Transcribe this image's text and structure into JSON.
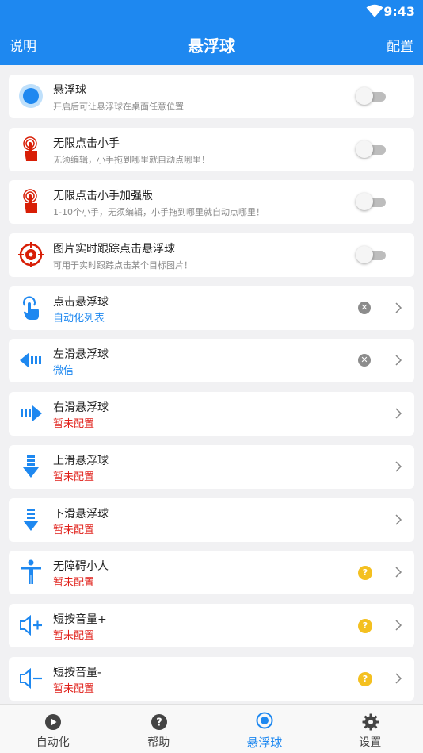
{
  "status_bar": {
    "time": "9:43"
  },
  "app_bar": {
    "left_label": "说明",
    "title": "悬浮球",
    "right_label": "配置"
  },
  "items": [
    {
      "title": "悬浮球",
      "desc": "开启后可让悬浮球在桌面任意位置",
      "icon": "floating-ball-icon"
    },
    {
      "title": "无限点击小手",
      "desc": "无须编辑，小手拖到哪里就自动点哪里！",
      "icon": "tap-hand-icon"
    },
    {
      "title": "无限点击小手加强版",
      "desc": "1-10个小手，无须编辑，小手拖到哪里就自动点哪里！",
      "icon": "tap-hand-plus-icon"
    },
    {
      "title": "图片实时跟踪点击悬浮球",
      "desc": "可用于实时跟踪点击某个目标图片！",
      "icon": "target-icon"
    },
    {
      "title": "点击悬浮球",
      "sub": "自动化列表",
      "icon": "touch-icon"
    },
    {
      "title": "左滑悬浮球",
      "sub": "微信",
      "icon": "swipe-left-icon"
    },
    {
      "title": "右滑悬浮球",
      "sub": "暂未配置",
      "icon": "swipe-right-icon"
    },
    {
      "title": "上滑悬浮球",
      "sub": "暂未配置",
      "icon": "swipe-up-icon"
    },
    {
      "title": "下滑悬浮球",
      "sub": "暂未配置",
      "icon": "swipe-down-icon"
    },
    {
      "title": "无障碍小人",
      "sub": "暂未配置",
      "icon": "accessibility-icon"
    },
    {
      "title": "短按音量+",
      "sub": "暂未配置",
      "icon": "volume-up-icon"
    },
    {
      "title": "短按音量-",
      "sub": "暂未配置",
      "icon": "volume-down-icon"
    }
  ],
  "bottom_nav": [
    {
      "label": "自动化",
      "icon": "play-circle-icon"
    },
    {
      "label": "帮助",
      "icon": "help-circle-icon"
    },
    {
      "label": "悬浮球",
      "icon": "radio-button-icon",
      "active": true
    },
    {
      "label": "设置",
      "icon": "gear-icon"
    }
  ],
  "colors": {
    "primary": "#1e88f0",
    "warning": "#e0201a",
    "help": "#f4c020",
    "icon_red": "#d81e06"
  }
}
